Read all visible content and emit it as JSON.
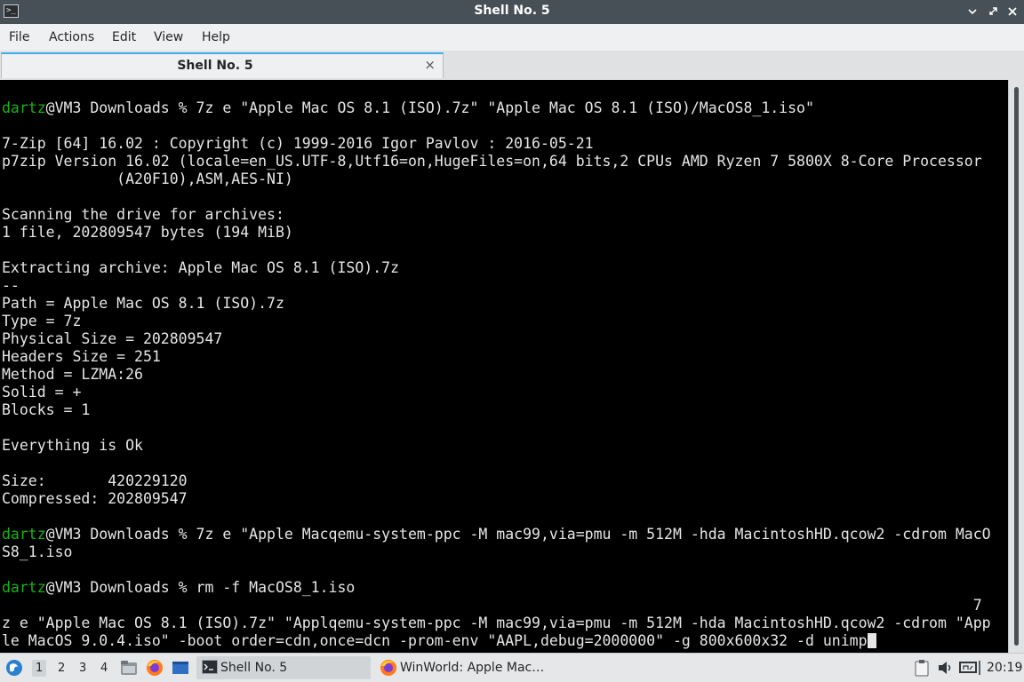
{
  "window": {
    "title": "Shell No. 5",
    "icon": "terminal-icon",
    "controls": [
      "minimize-icon",
      "maximize-icon",
      "close-icon"
    ]
  },
  "menubar": {
    "file": "File",
    "actions": "Actions",
    "edit": "Edit",
    "view": "View",
    "help": "Help"
  },
  "tab": {
    "label": "Shell No. 5",
    "close": "×"
  },
  "terminal": {
    "user_color": "#18b218",
    "lines": {
      "l1_user": "dartz",
      "l1_rest": "@VM3 Downloads % 7z e \"Apple Mac OS 8.1 (ISO).7z\" \"Apple Mac OS 8.1 (ISO)/MacOS8_1.iso\"",
      "l2": "",
      "l3": "7-Zip [64] 16.02 : Copyright (c) 1999-2016 Igor Pavlov : 2016-05-21",
      "l4": "p7zip Version 16.02 (locale=en_US.UTF-8,Utf16=on,HugeFiles=on,64 bits,2 CPUs AMD Ryzen 7 5800X 8-Core Processor",
      "l5": "             (A20F10),ASM,AES-NI)",
      "l6": "",
      "l7": "Scanning the drive for archives:",
      "l8": "1 file, 202809547 bytes (194 MiB)",
      "l9": "",
      "l10": "Extracting archive: Apple Mac OS 8.1 (ISO).7z",
      "l11": "--",
      "l12": "Path = Apple Mac OS 8.1 (ISO).7z",
      "l13": "Type = 7z",
      "l14": "Physical Size = 202809547",
      "l15": "Headers Size = 251",
      "l16": "Method = LZMA:26",
      "l17": "Solid = +",
      "l18": "Blocks = 1",
      "l19": "",
      "l20": "Everything is Ok",
      "l21": "",
      "l22": "Size:       420229120",
      "l23": "Compressed: 202809547",
      "l24": "",
      "l25_user": "dartz",
      "l25_rest": "@VM3 Downloads % 7z e \"Apple Macqemu-system-ppc -M mac99,via=pmu -m 512M -hda MacintoshHD.qcow2 -cdrom MacO",
      "l26": "S8_1.iso",
      "l27": "",
      "l28_user": "dartz",
      "l28_rest": "@VM3 Downloads % rm -f MacOS8_1.iso",
      "l29": "                                                                                                              7",
      "l30": "z e \"Apple Mac OS 8.1 (ISO).7z\" \"Applqemu-system-ppc -M mac99,via=pmu -m 512M -hda MacintoshHD.qcow2 -cdrom \"App",
      "l31": "le MacOS 9.0.4.iso\" -boot order=cdn,once=dcn -prom-env \"AAPL,debug=2000000\" -g 800x600x32 -d unimp"
    }
  },
  "taskbar": {
    "start_icon": "lxqt-menu-icon",
    "workspaces": [
      "1",
      "2",
      "3",
      "4"
    ],
    "active_workspace": "1",
    "launchers": [
      "file-manager-icon",
      "firefox-icon",
      "show-desktop-icon"
    ],
    "tasks": [
      {
        "label": "Shell No. 5",
        "icon": "terminal-icon"
      },
      {
        "label": "WinWorld: Apple Mac…",
        "icon": "firefox-icon"
      }
    ],
    "tray": [
      "clipboard-icon",
      "volume-icon",
      "network-icon",
      "power-icon"
    ],
    "clock": "20:19"
  }
}
